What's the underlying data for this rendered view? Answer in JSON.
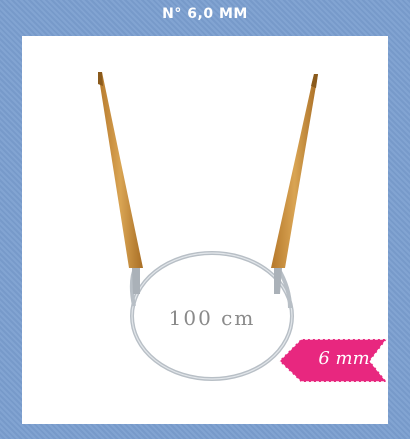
{
  "title": "N° 6,0 MM",
  "product": {
    "circumference_label": "100 cm",
    "size_badge": "6 mm",
    "badge_color": "#e8277f",
    "needle_color": "#c98f3c",
    "cable_color": "#b8bfc6"
  }
}
